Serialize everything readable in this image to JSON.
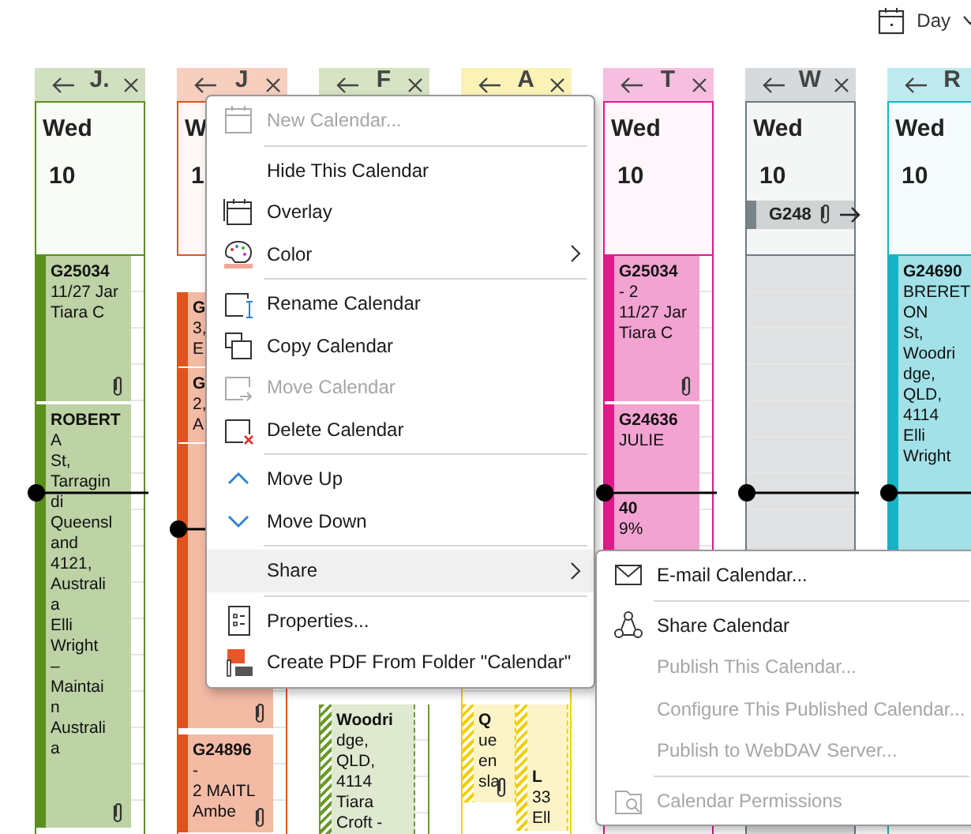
{
  "toolbar": {
    "view": "Day"
  },
  "calendars": [
    {
      "label": "J.",
      "color": "#5a8f1e",
      "weekday": "Wed",
      "day": "10",
      "appointments": [
        {
          "lines": [
            "G25034",
            "11/27 Jar",
            "Tiara C"
          ],
          "attachment": true
        },
        {
          "lines": [
            "ROBERT",
            "A",
            "St,",
            "Tarragin",
            "di",
            "Queensl",
            "and",
            "4121,",
            "Australi",
            "a",
            "Elli",
            "Wright",
            "–",
            "Maintai",
            "n",
            "Australi",
            "a"
          ],
          "attachment": true
        }
      ]
    },
    {
      "label": "J",
      "color": "#e0531c",
      "weekday": "W",
      "day": "1",
      "appointments": [
        {
          "lines": [
            "G",
            "3,",
            "E"
          ]
        },
        {
          "lines": [
            "G",
            "2,",
            "A"
          ]
        },
        {
          "attachment": true
        },
        {
          "lines": [
            "G24896",
            "-",
            "2 MAITL",
            "Ambe"
          ],
          "attachment": true
        }
      ]
    },
    {
      "label": "F",
      "color": "#6a9a2a",
      "appointments": [
        {
          "lines": [
            "Woodri",
            "dge,",
            "QLD,",
            "4114",
            "Tiara",
            "Croft -"
          ],
          "tentative": true
        }
      ]
    },
    {
      "label": "A",
      "color": "#f0cf00",
      "split": true,
      "appointments": [
        {
          "lines": [
            "Q",
            "ue",
            "en",
            "sla"
          ],
          "attachment": true,
          "tentative": true
        },
        {
          "lines": [
            "L",
            "33",
            "Ell"
          ],
          "tentative": true
        }
      ]
    },
    {
      "label": "T",
      "color": "#e0198c",
      "weekday": "Wed",
      "day": "10",
      "appointments": [
        {
          "lines": [
            "G25034",
            "- 2",
            "11/27 Jar",
            "Tiara C"
          ],
          "attachment": true
        },
        {
          "lines": [
            "G24636",
            "JULIE"
          ]
        },
        {
          "lines": [
            "40",
            "9%"
          ]
        }
      ]
    },
    {
      "label": "W",
      "color": "#6b7b82",
      "weekday": "Wed",
      "day": "10",
      "shaded": true,
      "all_day": {
        "text": "G248",
        "attachment": true
      }
    },
    {
      "label": "R",
      "color": "#17b4c6",
      "weekday": "Wed",
      "day": "10",
      "appointments": [
        {
          "lines": [
            "G24690",
            "BRERET",
            "ON",
            "St,",
            "Woodri",
            "dge,",
            "QLD,",
            "4114",
            "Elli",
            "Wright"
          ]
        }
      ]
    }
  ],
  "context_menu": {
    "items": [
      {
        "kind": "item",
        "label": "New Calendar...",
        "disabled": true,
        "highlighted": false,
        "submenu": false
      },
      {
        "kind": "separator"
      },
      {
        "kind": "item",
        "label": "Hide This Calendar",
        "disabled": false,
        "highlighted": false,
        "submenu": false
      },
      {
        "kind": "item",
        "label": "Overlay",
        "disabled": false,
        "highlighted": false,
        "submenu": false
      },
      {
        "kind": "item",
        "label": "Color",
        "disabled": false,
        "highlighted": false,
        "submenu": true
      },
      {
        "kind": "separator"
      },
      {
        "kind": "item",
        "label": "Rename Calendar",
        "disabled": false,
        "highlighted": false,
        "submenu": false
      },
      {
        "kind": "item",
        "label": "Copy Calendar",
        "disabled": false,
        "highlighted": false,
        "submenu": false
      },
      {
        "kind": "item",
        "label": "Move Calendar",
        "disabled": true,
        "highlighted": false,
        "submenu": false
      },
      {
        "kind": "item",
        "label": "Delete Calendar",
        "disabled": false,
        "highlighted": false,
        "submenu": false
      },
      {
        "kind": "separator"
      },
      {
        "kind": "item",
        "label": "Move Up",
        "disabled": false,
        "highlighted": false,
        "submenu": false
      },
      {
        "kind": "item",
        "label": "Move Down",
        "disabled": false,
        "highlighted": false,
        "submenu": false
      },
      {
        "kind": "separator"
      },
      {
        "kind": "item",
        "label": "Share",
        "disabled": false,
        "highlighted": true,
        "submenu": true
      },
      {
        "kind": "separator"
      },
      {
        "kind": "item",
        "label": "Properties...",
        "disabled": false,
        "highlighted": false,
        "submenu": false
      },
      {
        "kind": "item",
        "label": "Create PDF From Folder \"Calendar\"",
        "disabled": false,
        "highlighted": false,
        "submenu": false
      }
    ]
  },
  "share_submenu": {
    "items": [
      {
        "kind": "item",
        "label": "E-mail Calendar...",
        "disabled": false
      },
      {
        "kind": "separator"
      },
      {
        "kind": "item",
        "label": "Share Calendar",
        "disabled": false
      },
      {
        "kind": "item",
        "label": "Publish This Calendar...",
        "disabled": true
      },
      {
        "kind": "item",
        "label": "Configure This Published Calendar...",
        "disabled": true
      },
      {
        "kind": "item",
        "label": "Publish to WebDAV Server...",
        "disabled": true
      },
      {
        "kind": "separator"
      },
      {
        "kind": "item",
        "label": "Calendar Permissions",
        "disabled": true
      }
    ]
  }
}
